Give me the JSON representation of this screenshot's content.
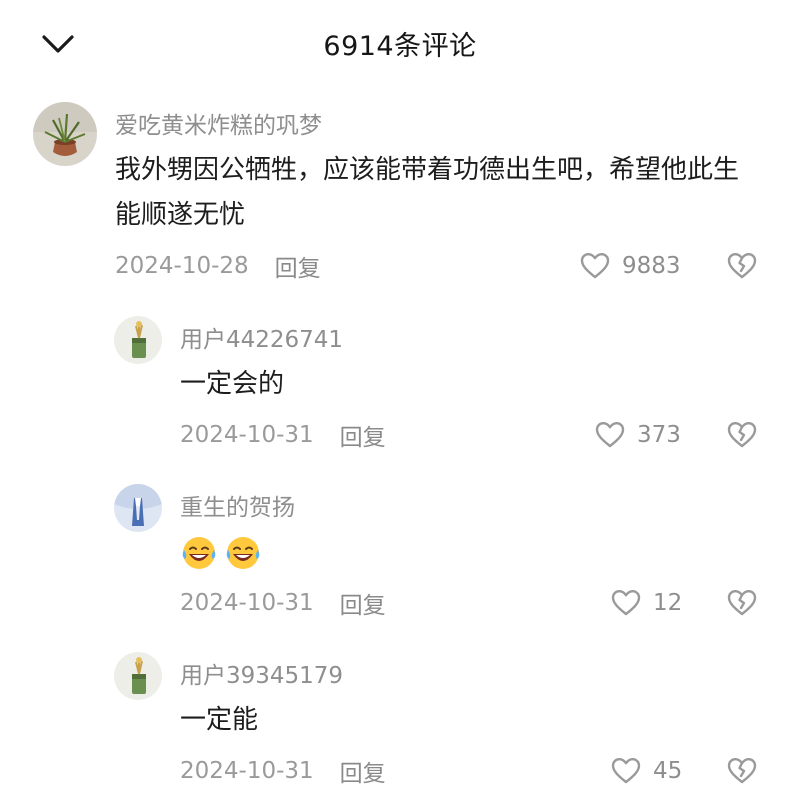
{
  "header": {
    "title": "6914条评论"
  },
  "comments": [
    {
      "username": "爱吃黄米炸糕的巩梦",
      "content": "我外甥因公牺牲，应该能带着功德出生吧，希望他此生能顺遂无忧",
      "date": "2024-10-28",
      "reply_label": "回复",
      "likes": "9883"
    },
    {
      "username": "用户44226741",
      "content": "一定会的",
      "date": "2024-10-31",
      "reply_label": "回复",
      "likes": "373"
    },
    {
      "username": "重生的贺扬",
      "content_emojis": [
        "laughing-tears",
        "laughing-tears"
      ],
      "date": "2024-10-31",
      "reply_label": "回复",
      "likes": "12"
    },
    {
      "username": "用户39345179",
      "content": "一定能",
      "date": "2024-10-31",
      "reply_label": "回复",
      "likes": "45"
    }
  ],
  "icons": {
    "back": "chevron-down-icon",
    "like": "heart-outline-icon",
    "dislike": "broken-heart-icon",
    "emoji": "laughing-tears-emoji"
  },
  "colors": {
    "text_primary": "#1d1d1d",
    "text_secondary": "#8e8e8e",
    "background": "#ffffff"
  }
}
